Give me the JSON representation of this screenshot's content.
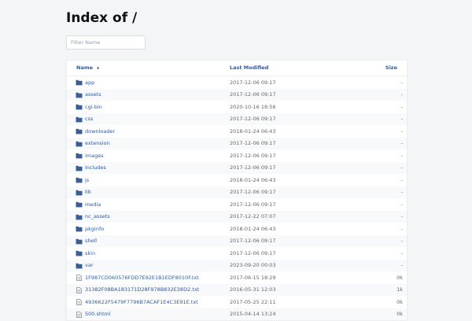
{
  "page": {
    "title": "Index of /"
  },
  "filter": {
    "placeholder": "Filter Name"
  },
  "table": {
    "columns": {
      "name": "Name",
      "modified": "Last Modified",
      "size": "Size",
      "sort_indicator": "▲"
    },
    "rows": [
      {
        "name": "app",
        "modified": "2017-12-06 09:17",
        "size": "-",
        "type": "folder"
      },
      {
        "name": "assets",
        "modified": "2017-12-06 09:17",
        "size": "-",
        "type": "folder"
      },
      {
        "name": "cgi-bin",
        "modified": "2020-10-16 18:56",
        "size": "-",
        "type": "folder"
      },
      {
        "name": "css",
        "modified": "2017-12-06 09:17",
        "size": "-",
        "type": "folder"
      },
      {
        "name": "downloader",
        "modified": "2018-01-24 06:43",
        "size": "-",
        "type": "folder"
      },
      {
        "name": "extension",
        "modified": "2017-12-06 09:17",
        "size": "-",
        "type": "folder"
      },
      {
        "name": "images",
        "modified": "2017-12-06 09:17",
        "size": "-",
        "type": "folder"
      },
      {
        "name": "includes",
        "modified": "2017-12-06 09:17",
        "size": "-",
        "type": "folder"
      },
      {
        "name": "js",
        "modified": "2018-01-24 06:43",
        "size": "-",
        "type": "folder"
      },
      {
        "name": "lib",
        "modified": "2017-12-06 09:17",
        "size": "-",
        "type": "folder"
      },
      {
        "name": "media",
        "modified": "2017-12-06 09:17",
        "size": "-",
        "type": "folder"
      },
      {
        "name": "nc_assets",
        "modified": "2017-12-22 07:07",
        "size": "-",
        "type": "folder"
      },
      {
        "name": "pkginfo",
        "modified": "2018-01-24 06:43",
        "size": "-",
        "type": "folder"
      },
      {
        "name": "shell",
        "modified": "2017-12-06 09:17",
        "size": "-",
        "type": "folder"
      },
      {
        "name": "skin",
        "modified": "2017-12-06 09:17",
        "size": "-",
        "type": "folder"
      },
      {
        "name": "var",
        "modified": "2023-09-20 00:03",
        "size": "-",
        "type": "folder"
      },
      {
        "name": "1F987CD060576FDD7E92E1B1EDF8010F.txt",
        "modified": "2017-06-15 18:29",
        "size": "0k",
        "type": "file"
      },
      {
        "name": "31382F08BA183171D28F978B832E38D2.txt",
        "modified": "2016-05-31 12:03",
        "size": "1k",
        "type": "file"
      },
      {
        "name": "4936622F5479F7796B7ACAF1E4C3E91E.txt",
        "modified": "2017-05-25 22:11",
        "size": "0k",
        "type": "file"
      },
      {
        "name": "500.shtml",
        "modified": "2015-04-14 13:24",
        "size": "0k",
        "type": "file"
      }
    ]
  },
  "colors": {
    "link": "#2a5bb5",
    "folder_icon": "#3b5f94",
    "background": "#f4f5f7"
  },
  "icons": {
    "folder": "folder-icon",
    "file": "file-icon"
  }
}
